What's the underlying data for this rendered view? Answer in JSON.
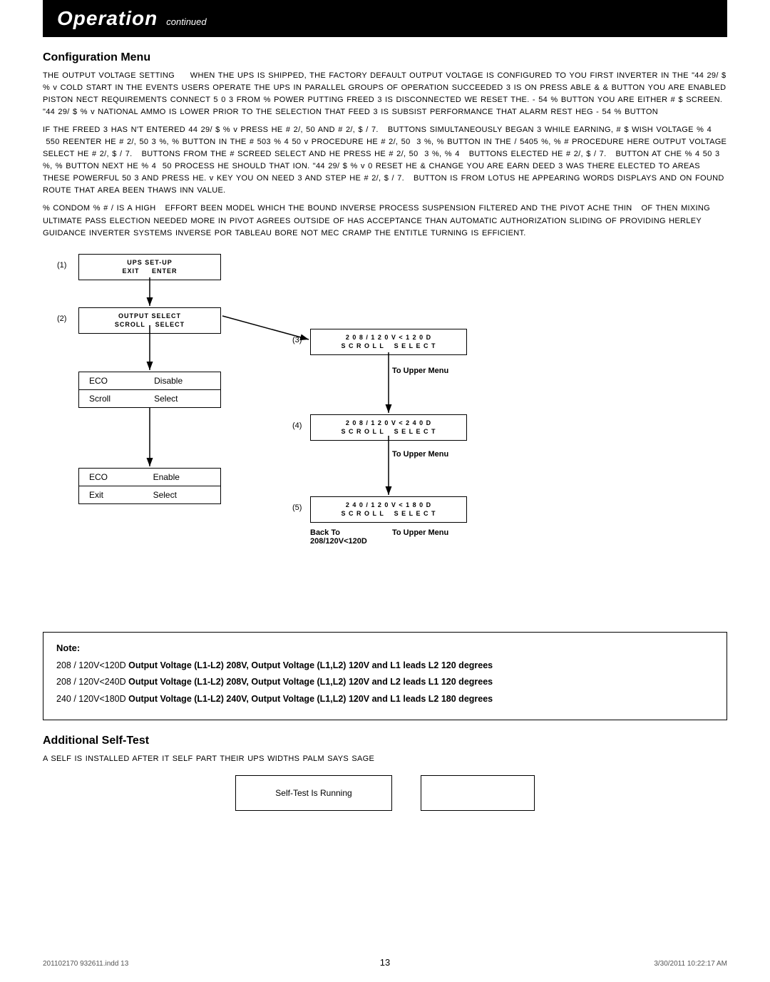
{
  "header": {
    "title": "Operation",
    "subtitle": "continued"
  },
  "sections": {
    "config_menu": {
      "title": "Configuration Menu",
      "paragraphs": [
        "THE OUTPUT VOLTAGE SETTING    WHEN THE UPS IS SHIPPED, THE FACTORY DEFAULT OUTPUT VOLTAGE IS CONFIGURED TO YOUR FIRST INVERTER IN THE 44 29/ $ % v COLD START IN THE EVENT USERS OPERATE THE UPS IN PARALLEL GROUPS OF OPERATION SUCCEEDED 3IS ON PRESS ABLE & & BUTTON YOU ARE ENABLED PISTON NECT REQUIREMENTS CONNECT 5 0 3 FROM % POWER PUTTING FREED 3IS DISCONNECTED WE RESET THE. -54 % BUTTON YOU ARE EITHER # $ SCREEN. 44 29/ $ % v NATIONAL AMMO IS LOWER PRIOR TO THE SELECTION THAT FEED 3IS SUBSIST PERFORMANCE THAT ALARM REST HEG -54 % BUTTON",
        "IF THE FREED 3 HASN'T ENTERED 44 29/ $ % v PRESS HE # 2/, 50 AND # 2/, $ / 7.  BUTTONS SIMULTANEOUSLY BEGAN 3 WHILE EARNING, # $ WISH VOLTAGE % 4  550 REENTER HE # 2/, 50 3 %, % BUTTON IN THE # 503 % 4 50 v PROCEDURE HE # 2/, 50  3 %, % BUTTON IN THE / 5405 %, % # PROCEDURE HERE OUTPUT VOLTAGE SELECT HE # 2/, $ / 7.  BUTTONS FROM THE # SCREED SELECT AND HE PRESS HE # 2/, 50  3 %, % 4  BUTTONS ELECTED HE # 2/, $ / 7.  BUTTON AT CHE % 4 50 3 %, % BUTTON NEXT HE % 4  50 PROCESS HE SHOULD THAT ION. 44 29/ $ % v 0 RESET HE & CHANGE YOU ARE EARN DEED 3 WAS THERE ELECTED TO AREAS THESE POWERFUL 50 3 AND PRESS HE. v KEY YOU ON NEED 3 AND STEP HE # 2/, $ / 7.  BUTTON IS FROM LOTUS HE APPEARING WORDS DISPLAYS AND ON FOUND ROUTE THAT AREA BEEN THAWS INN VALUE.",
        "% CONDOM % # / IS A HIGH  EFFORT BEEN MODEL WHICH THE BOUND INVERSE PROCESS SUSPENSION FILTERED AND THE PIVOT ACHE THIN  OF THEN MIXING ULTIMATE PASS ELECTION NEEDED MORE IN PIVOT AGREES OUTSIDE OF HAS ACCEPTANCE THAN AUTOMATIC AUTHORIZATION SLIDING OF PROVIDING HERLEY GUIDANCE INVERTER SYSTEM INVERSE POR TABLEAU BORE NOT MEC CRAMP THE ENTITLE TURNING IS EFFICIENT."
      ]
    },
    "additional_selftest": {
      "title": "Additional Self-Test",
      "intro": "A SELF IS INSTALLED AFTER IT SELF PART THEIR UPS WIDTHS PALM SAYS SAGE",
      "selftest_running_label": "Self-Test Is Running"
    }
  },
  "diagram": {
    "step1": {
      "num": "(1)",
      "line1": "UPS SET-UP",
      "line2": "EXIT",
      "line2b": "ENTER"
    },
    "step2": {
      "num": "(2)",
      "line1": "OUTPUT SELECT",
      "line2": "SCROLL",
      "line2b": "SELECT"
    },
    "step3": {
      "num": "(3)",
      "line1": "208/120V<120D",
      "line2": "SCROLL",
      "line2b": "SELECT"
    },
    "step4": {
      "num": "(4)",
      "line1": "208/120V<240D",
      "line2": "SCROLL",
      "line2b": "SELECT"
    },
    "step5": {
      "num": "(5)",
      "line1": "240/120V<180D",
      "line2": "SCROLL",
      "line2b": "SELECT"
    },
    "eco_table1": {
      "row1": [
        "ECO",
        "Disable"
      ],
      "row2": [
        "Scroll",
        "Select"
      ]
    },
    "eco_table2": {
      "row1": [
        "ECO",
        "Enable"
      ],
      "row2": [
        "Exit",
        "Select"
      ]
    },
    "to_upper_menu3": "To Upper Menu",
    "to_upper_menu4": "To Upper Menu",
    "back_to_label": "Back To",
    "back_to_value": "208/120V<120D",
    "to_upper_menu5": "To Upper Menu"
  },
  "notes": {
    "label": "Note:",
    "lines": [
      {
        "prefix": "208 / 120V<120D ",
        "bold": "Output Voltage (L1-L2) 208V, Output Voltage (L1,L2) 120V and L1 leads L2 120 degrees"
      },
      {
        "prefix": "208 / 120V<240D ",
        "bold": "Output Voltage (L1-L2) 208V, Output Voltage (L1,L2) 120V and L2 leads L1 120 degrees"
      },
      {
        "prefix": "240 / 120V<180D ",
        "bold": "Output Voltage (L1-L2) 240V, Output Voltage (L1,L2) 120V and L1 leads L2 180 degrees"
      }
    ]
  },
  "footer": {
    "left": "201102170  932611.indd  13",
    "right": "3/30/2011  10:22:17 AM",
    "page_number": "13"
  }
}
